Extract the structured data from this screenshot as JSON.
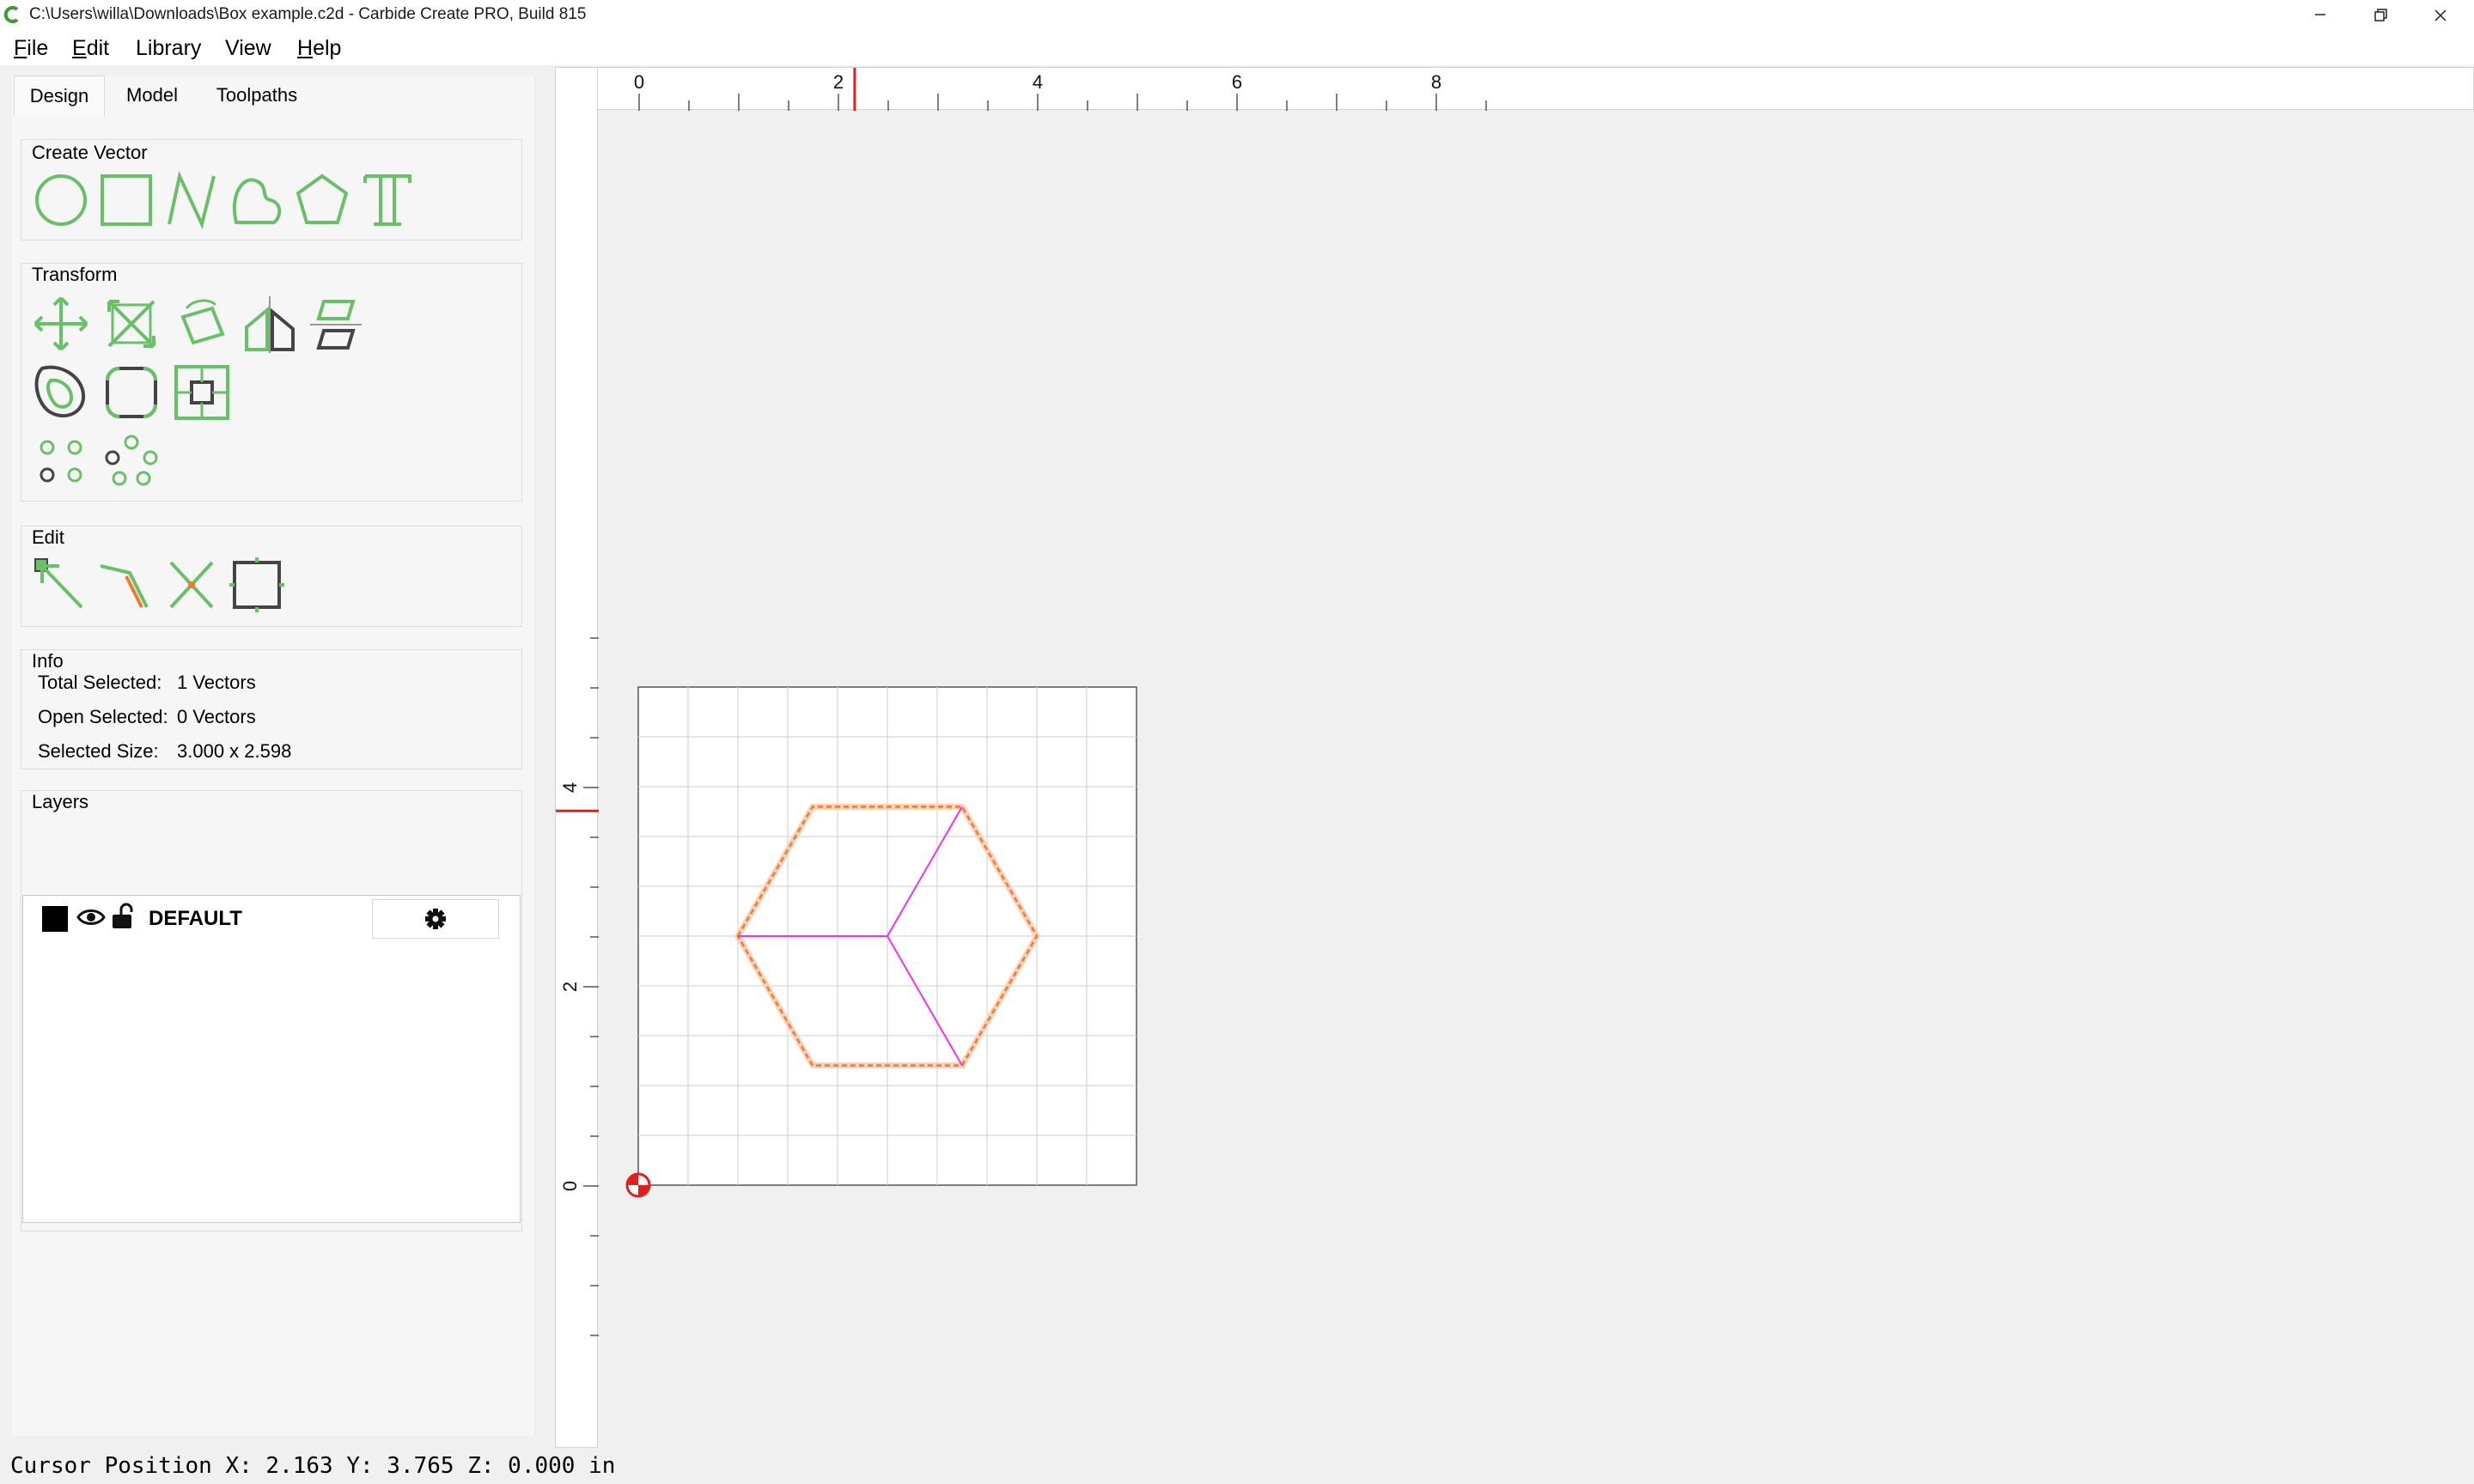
{
  "window": {
    "title": "C:\\Users\\willa\\Downloads\\Box example.c2d - Carbide Create PRO, Build 815",
    "app_icon": "carbide-logo-icon",
    "controls": [
      "minimize-icon",
      "restore-icon",
      "close-icon"
    ]
  },
  "menu": [
    {
      "label": "File",
      "mnemonic": "F",
      "rest": "ile"
    },
    {
      "label": "Edit",
      "mnemonic": "E",
      "rest": "dit"
    },
    {
      "label": "Library",
      "mnemonic": "",
      "rest": "Library"
    },
    {
      "label": "View",
      "mnemonic": "",
      "rest": "View"
    },
    {
      "label": "Help",
      "mnemonic": "H",
      "rest": "elp"
    }
  ],
  "tabs": [
    {
      "label": "Design",
      "active": true
    },
    {
      "label": "Model",
      "active": false
    },
    {
      "label": "Toolpaths",
      "active": false
    }
  ],
  "create_vector": {
    "title": "Create Vector",
    "tools": [
      "circle-icon",
      "rectangle-icon",
      "polyline-icon",
      "curve-icon",
      "polygon-icon",
      "text-icon"
    ]
  },
  "transform": {
    "title": "Transform",
    "tools": [
      "move-icon",
      "scale-icon",
      "rotate-icon",
      "mirror-icon",
      "align-icon",
      "offset-icon",
      "fillet-icon",
      "center-icon",
      "grid-array-icon",
      "circular-array-icon"
    ]
  },
  "edit": {
    "title": "Edit",
    "tools": [
      "node-edit-icon",
      "trim-icon",
      "cut-icon",
      "bounding-box-icon"
    ]
  },
  "info": {
    "title": "Info",
    "rows": [
      {
        "label": "Total Selected:",
        "value": "1 Vectors"
      },
      {
        "label": "Open Selected:",
        "value": "0 Vectors"
      },
      {
        "label": "Selected Size:",
        "value": "3.000 x 2.598"
      }
    ]
  },
  "layers": {
    "title": "Layers",
    "items": [
      {
        "name": "DEFAULT",
        "color": "#000000",
        "visible": true,
        "locked": false
      }
    ]
  },
  "rulers": {
    "top_labels": [
      "0",
      "2",
      "4",
      "6",
      "8"
    ],
    "left_labels": [
      "4",
      "2",
      "0"
    ],
    "cursor_x": 2.163,
    "cursor_y": 3.765
  },
  "colors": {
    "accent_green": "#6abf69",
    "selection_orange": "#f07a2e",
    "magenta": "#ee33ee",
    "cursor_red": "#e02020"
  },
  "status": {
    "text": "Cursor Position X: 2.163 Y: 3.765 Z: 0.000 in"
  }
}
